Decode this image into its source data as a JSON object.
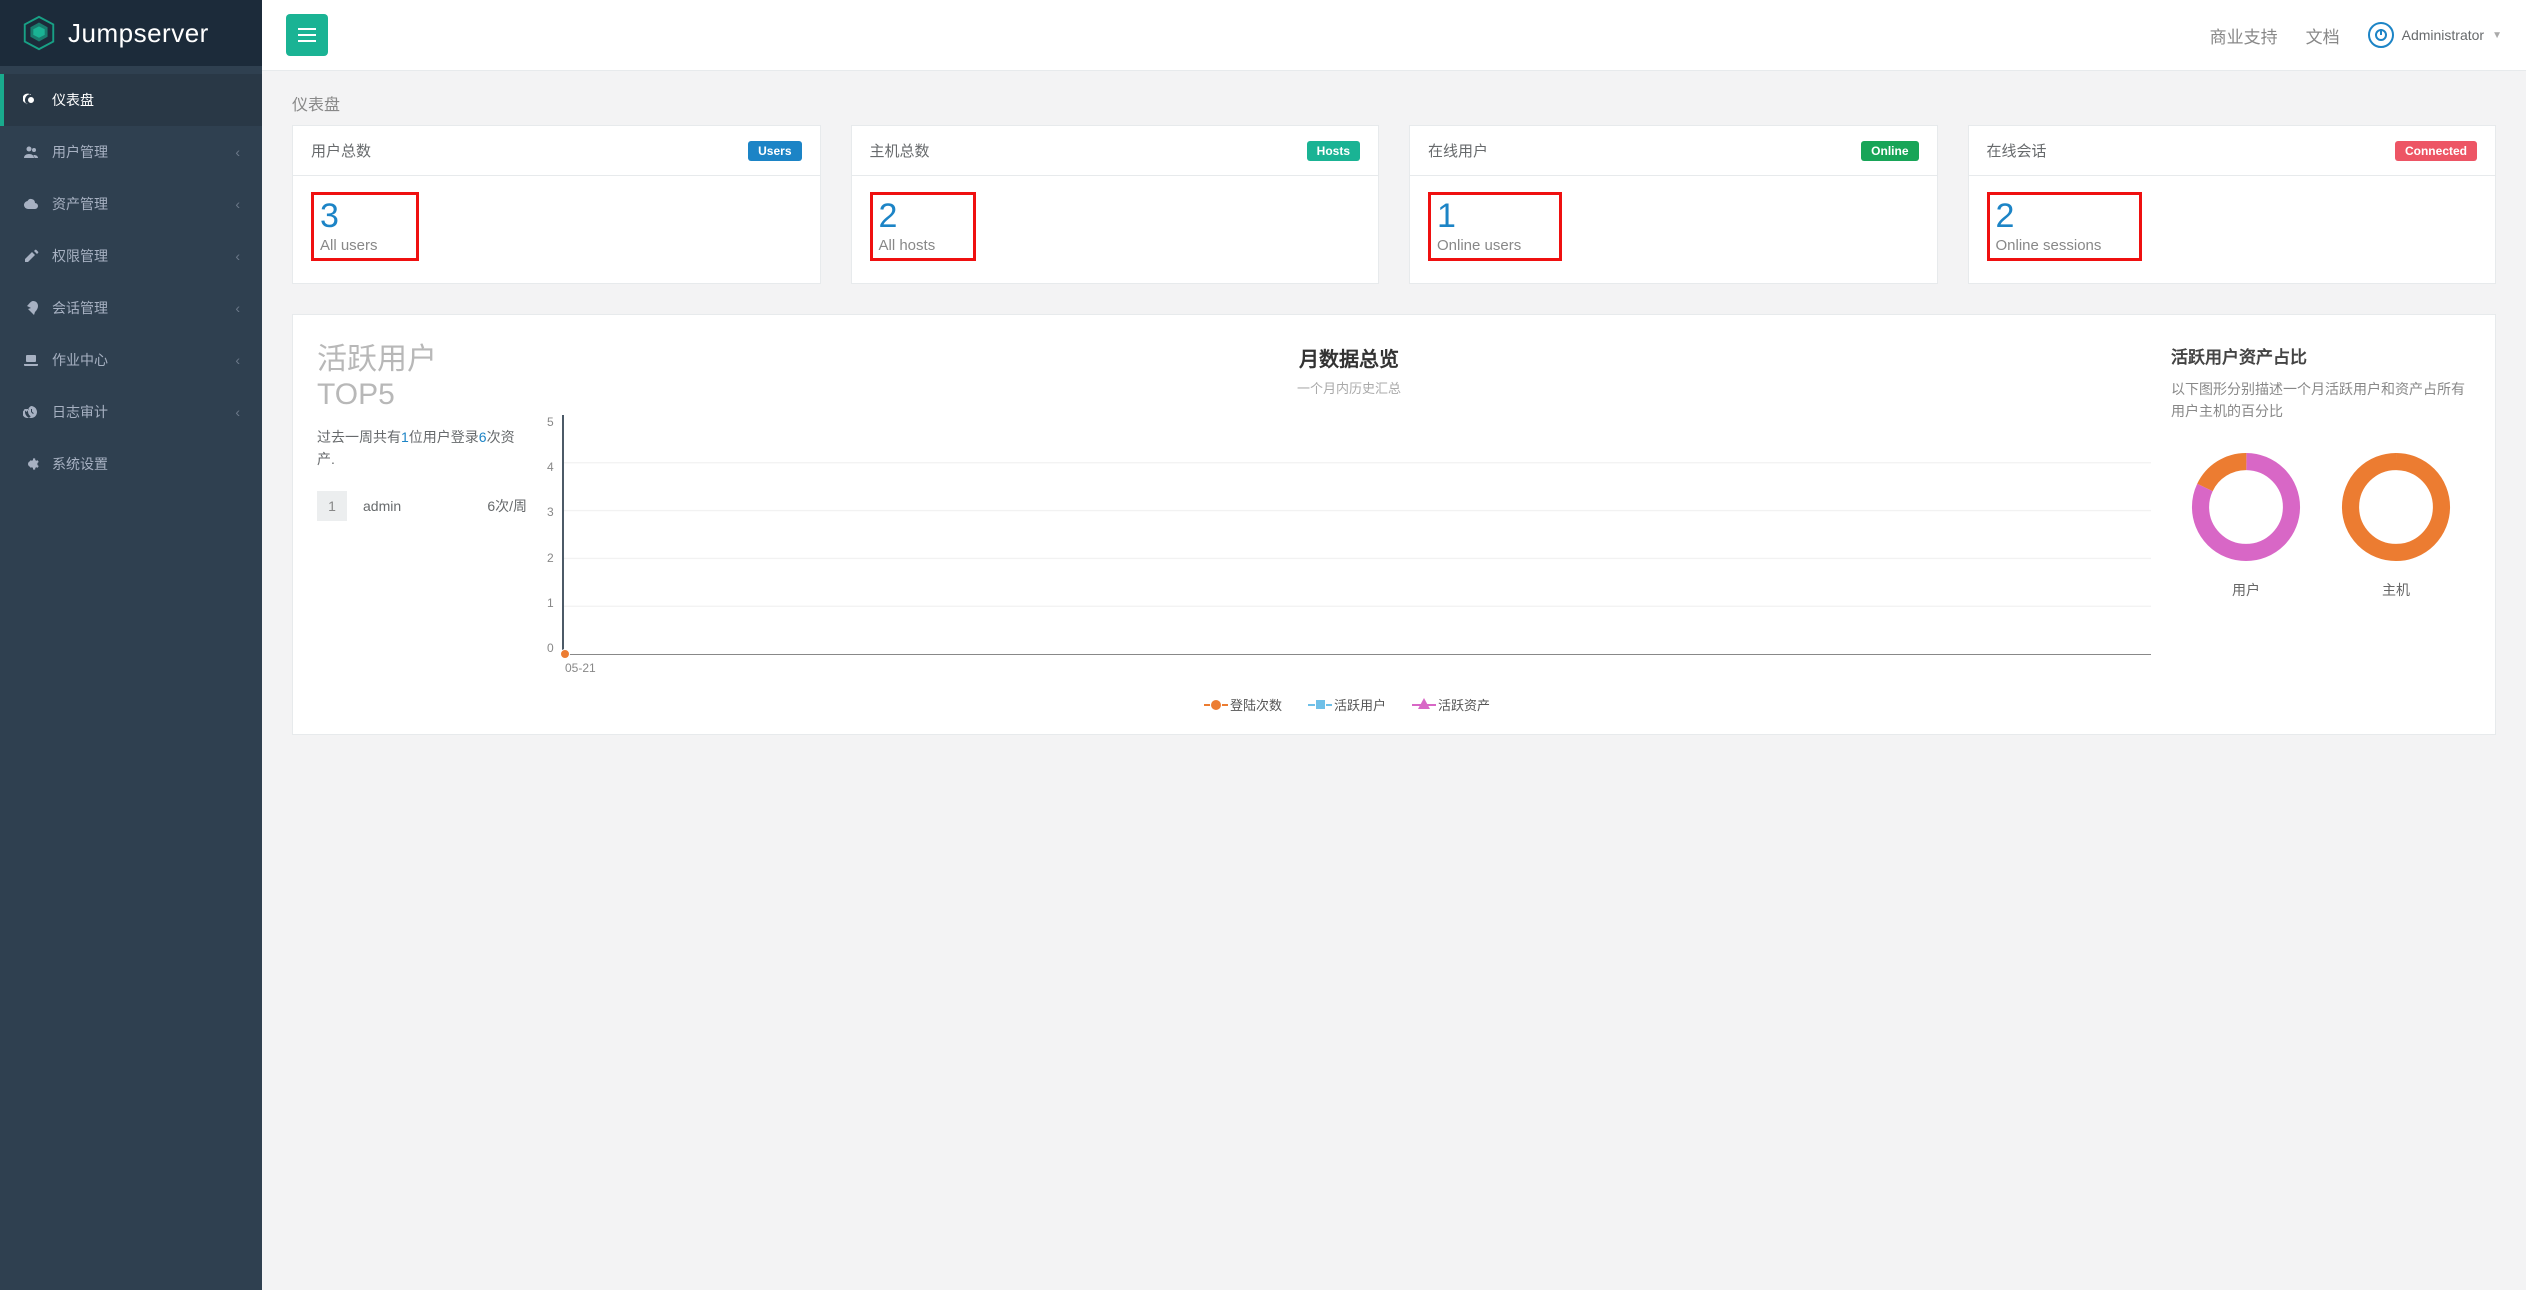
{
  "brand": "Jumpserver",
  "topbar": {
    "links": [
      "商业支持",
      "文档"
    ],
    "user": "Administrator"
  },
  "sidebar": {
    "items": [
      {
        "label": "仪表盘",
        "icon": "dashboard",
        "active": true,
        "expand": false
      },
      {
        "label": "用户管理",
        "icon": "users",
        "active": false,
        "expand": true
      },
      {
        "label": "资产管理",
        "icon": "cloud",
        "active": false,
        "expand": true
      },
      {
        "label": "权限管理",
        "icon": "edit",
        "active": false,
        "expand": true
      },
      {
        "label": "会话管理",
        "icon": "rocket",
        "active": false,
        "expand": true
      },
      {
        "label": "作业中心",
        "icon": "laptop",
        "active": false,
        "expand": true
      },
      {
        "label": "日志审计",
        "icon": "history",
        "active": false,
        "expand": true
      },
      {
        "label": "系统设置",
        "icon": "cog",
        "active": false,
        "expand": false
      }
    ]
  },
  "page_title": "仪表盘",
  "stats": [
    {
      "title": "用户总数",
      "badge": "Users",
      "badge_class": "badge-blue",
      "value": "3",
      "sub": "All users"
    },
    {
      "title": "主机总数",
      "badge": "Hosts",
      "badge_class": "badge-teal",
      "value": "2",
      "sub": "All hosts"
    },
    {
      "title": "在线用户",
      "badge": "Online",
      "badge_class": "badge-green",
      "value": "1",
      "sub": "Online users"
    },
    {
      "title": "在线会话",
      "badge": "Connected",
      "badge_class": "badge-red",
      "value": "2",
      "sub": "Online sessions"
    }
  ],
  "top5": {
    "title1": "活跃用户",
    "title2": "TOP5",
    "desc_pre": "过去一周共有",
    "desc_users": "1",
    "desc_mid": "位用户登录",
    "desc_times": "6",
    "desc_post": "次资产.",
    "rank": "1",
    "rank_name": "admin",
    "rank_count": "6次/周"
  },
  "chart": {
    "title": "月数据总览",
    "subtitle": "一个月内历史汇总",
    "x_label": "05-21",
    "legend": [
      "登陆次数",
      "活跃用户",
      "活跃资产"
    ]
  },
  "ratio": {
    "title": "活跃用户资产占比",
    "desc": "以下图形分别描述一个月活跃用户和资产占所有用户主机的百分比",
    "labels": [
      "用户",
      "主机"
    ]
  },
  "chart_data": {
    "type": "line",
    "title": "月数据总览",
    "subtitle": "一个月内历史汇总",
    "x": [
      "05-21"
    ],
    "series": [
      {
        "name": "登陆次数",
        "values": [
          0
        ]
      },
      {
        "name": "活跃用户",
        "values": [
          0
        ]
      },
      {
        "name": "活跃资产",
        "values": [
          0
        ]
      }
    ],
    "ylim": [
      0,
      5
    ],
    "y_ticks": [
      0,
      1,
      2,
      3,
      4,
      5
    ],
    "donuts": [
      {
        "label": "用户",
        "active_percent": 82,
        "colors": [
          "#d867c6",
          "#ec7c31"
        ]
      },
      {
        "label": "主机",
        "active_percent": 100,
        "colors": [
          "#ec7c31"
        ]
      }
    ]
  }
}
